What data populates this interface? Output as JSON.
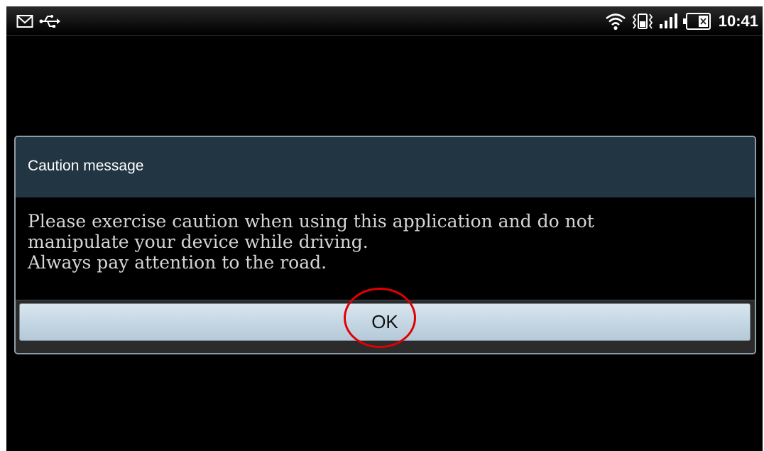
{
  "status_bar": {
    "time": "10:41",
    "left_icons": [
      "gmail-icon",
      "usb-icon"
    ],
    "right_icons": [
      "wifi-icon",
      "vibrate-icon",
      "signal-icon",
      "battery-icon"
    ]
  },
  "dialog": {
    "title": "Caution message",
    "body_lines": [
      "Please exercise caution when using this application and do not",
      "manipulate your device while driving.",
      "Always pay attention to the road."
    ],
    "ok_label": "OK"
  },
  "annotation": {
    "highlight_color": "#e00000",
    "highlight_target": "ok-button"
  },
  "colors": {
    "dialog_header": "#223542",
    "button_face": "#c4d6e3",
    "screen_background": "#000000"
  }
}
